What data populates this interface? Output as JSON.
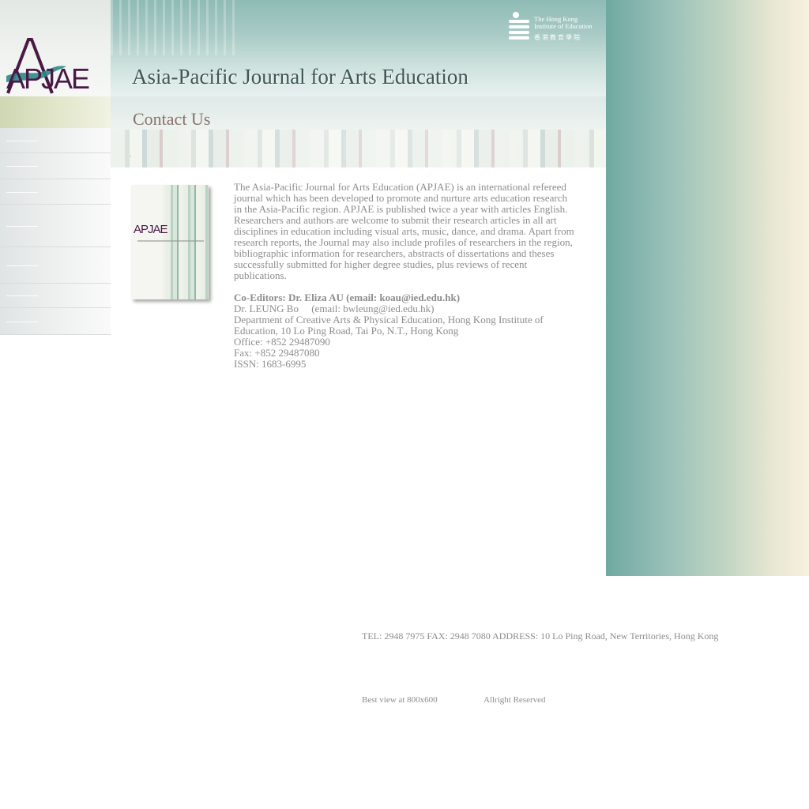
{
  "logo": {
    "text": "APJAE"
  },
  "header": {
    "title": "Asia-Pacific Journal for Arts Education",
    "institute_en": "The Hong Kong\nInstitute of Education",
    "institute_cn": "香港教育學院"
  },
  "page": {
    "section_title": "Contact Us"
  },
  "cover": {
    "logo_text": "APJAE"
  },
  "content": {
    "intro": "The Asia-Pacific Journal for Arts Education (APJAE) is an international refereed journal which has been developed to promote and nurture arts education research in the Asia-Pacific region. APJAE is published twice a year with articles English. Researchers and authors are welcome to submit their research articles in all art disciplines in education including visual arts, music, dance, and drama. Apart from research reports, the Journal may also include profiles of researchers in the region, bibliographic information for researchers, abstracts of dissertations and theses successfully submitted for higher degree studies, plus reviews of recent publications.",
    "co_editors": "Co-Editors: Dr. Eliza   AU (email: koau@ied.edu.hk)",
    "second_editor": "Dr. LEUNG Bo     (email: bwleung@ied.edu.hk)",
    "department": "Department of Creative Arts & Physical Education, Hong Kong Institute of Education, 10 Lo Ping Road, Tai Po, N.T., Hong Kong",
    "office": "Office: +852 29487090",
    "fax": "Fax: +852 29487080",
    "issn": "ISSN: 1683-6995"
  },
  "footer": {
    "address": "TEL: 2948 7975 FAX: 2948 7080 ADDRESS: 10 Lo Ping Road, New Territories, Hong Kong",
    "best_view": "Best view at 800x600",
    "rights": "Allright Reserved"
  },
  "colors": {
    "brand_purple": "#4a1846",
    "teal": "#6fa9a2",
    "text_gray": "#8c8c8c"
  }
}
